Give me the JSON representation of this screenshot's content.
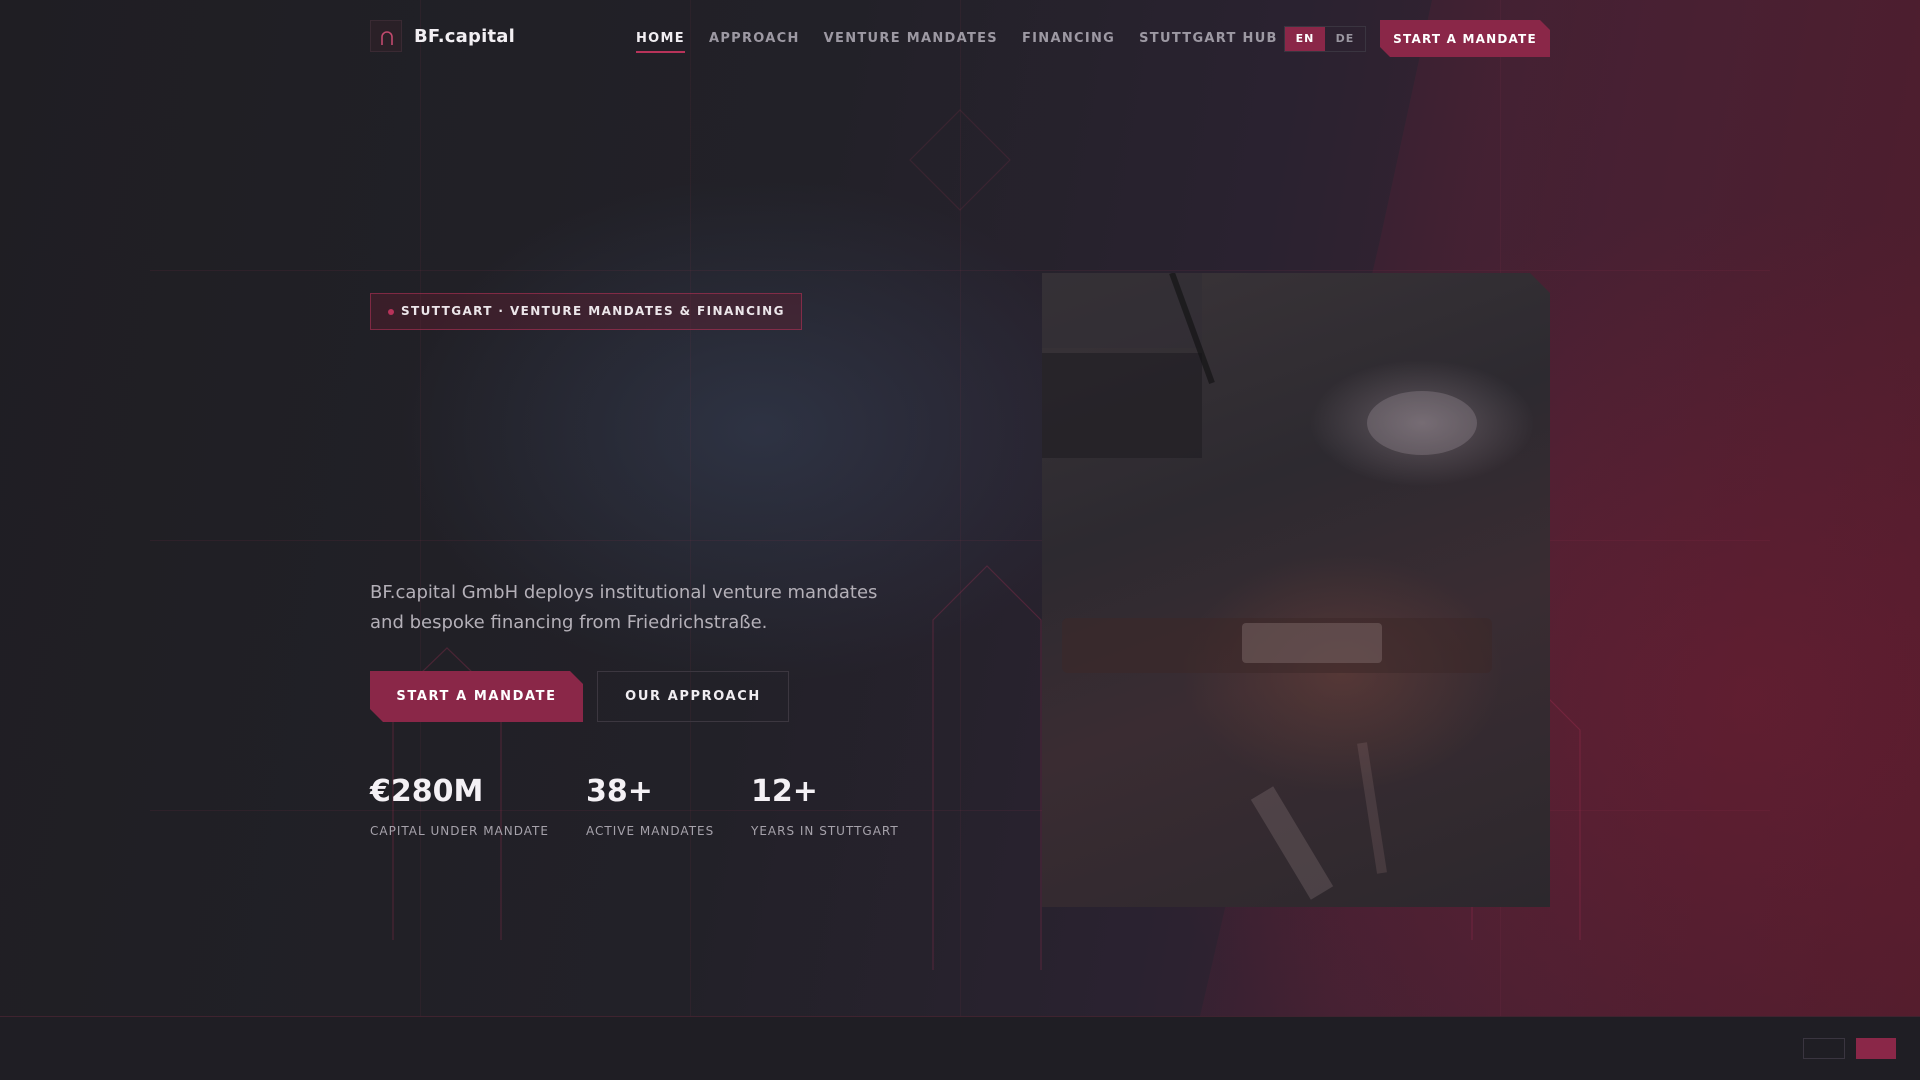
{
  "brand": {
    "name": "BF.capital"
  },
  "nav": {
    "items": [
      {
        "label": "HOME",
        "active": true
      },
      {
        "label": "APPROACH",
        "active": false
      },
      {
        "label": "VENTURE MANDATES",
        "active": false
      },
      {
        "label": "FINANCING",
        "active": false
      },
      {
        "label": "STUTTGART HUB",
        "active": false
      }
    ],
    "languages": [
      {
        "label": "EN",
        "selected": true
      },
      {
        "label": "DE",
        "selected": false
      }
    ],
    "cta": "START A MANDATE"
  },
  "hero": {
    "badge": "STUTTGART · VENTURE MANDATES & FINANCING",
    "description": "BF.capital GmbH deploys institutional venture mandates and bespoke financing from Friedrichstraße.",
    "primary_button": "START A MANDATE",
    "secondary_button": "OUR APPROACH",
    "stats": [
      {
        "value": "€280M",
        "label": "CAPITAL UNDER MANDATE"
      },
      {
        "value": "38+",
        "label": "ACTIVE MANDATES"
      },
      {
        "value": "12+",
        "label": "YEARS IN STUTTGART"
      }
    ]
  },
  "colors": {
    "accent": "#8a2748",
    "accent_line": "#b8335a",
    "background": "#1e1d22"
  },
  "icons": {
    "logo": "logo-arch-icon",
    "badge_dot": "dot-icon"
  }
}
